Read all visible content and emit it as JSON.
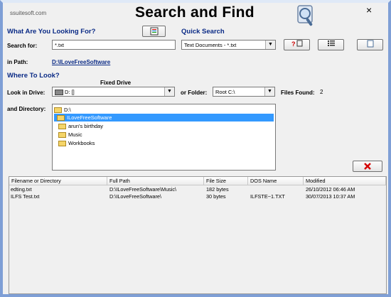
{
  "app": {
    "brand": "ssuitesoft.com",
    "title": "Search and Find",
    "close": "×"
  },
  "sections": {
    "looking_for": "What Are You Looking For?",
    "quick_search": "Quick Search",
    "where_to_look": "Where To Look?"
  },
  "search": {
    "label": "Search for:",
    "value": "*.txt"
  },
  "quick_search": {
    "selected": "Text Documents - *.txt"
  },
  "in_path": {
    "label": "in Path:",
    "value": "D:\\ILoveFreeSoftware"
  },
  "drive": {
    "header": "Fixed Drive",
    "label": "Look in Drive:",
    "selected": "D: []"
  },
  "folder": {
    "label": "or Folder:",
    "selected": "Root C:\\"
  },
  "files_found": {
    "label": "Files Found:",
    "count": "2"
  },
  "directory": {
    "label": "and Directory:",
    "nodes": [
      "D:\\",
      "ILoveFreeSoftware",
      "arun's birthday",
      "Music",
      "Workbooks"
    ]
  },
  "buttons": {
    "icon_button": "notebook-icon",
    "help": "help-icon",
    "list": "list-icon",
    "doc": "document-icon",
    "clear": "red-x-icon"
  },
  "results": {
    "columns": [
      "Filename or Directory",
      "Full Path",
      "File Size",
      "DOS Name",
      "Modified"
    ],
    "rows": [
      [
        "edting.txt",
        "D:\\ILoveFreeSoftware\\Music\\",
        "182 bytes",
        "",
        "26/10/2012 06:46 AM"
      ],
      [
        "ILFS Test.txt",
        "D:\\ILoveFreeSoftware\\",
        "30 bytes",
        "ILFSTE~1.TXT",
        "30/07/2013 10:37 AM"
      ]
    ]
  },
  "colors": {
    "accent": "#0b2b86",
    "selection": "#3399ff",
    "folder": "#f5d569",
    "clear_icon": "#d40000"
  }
}
